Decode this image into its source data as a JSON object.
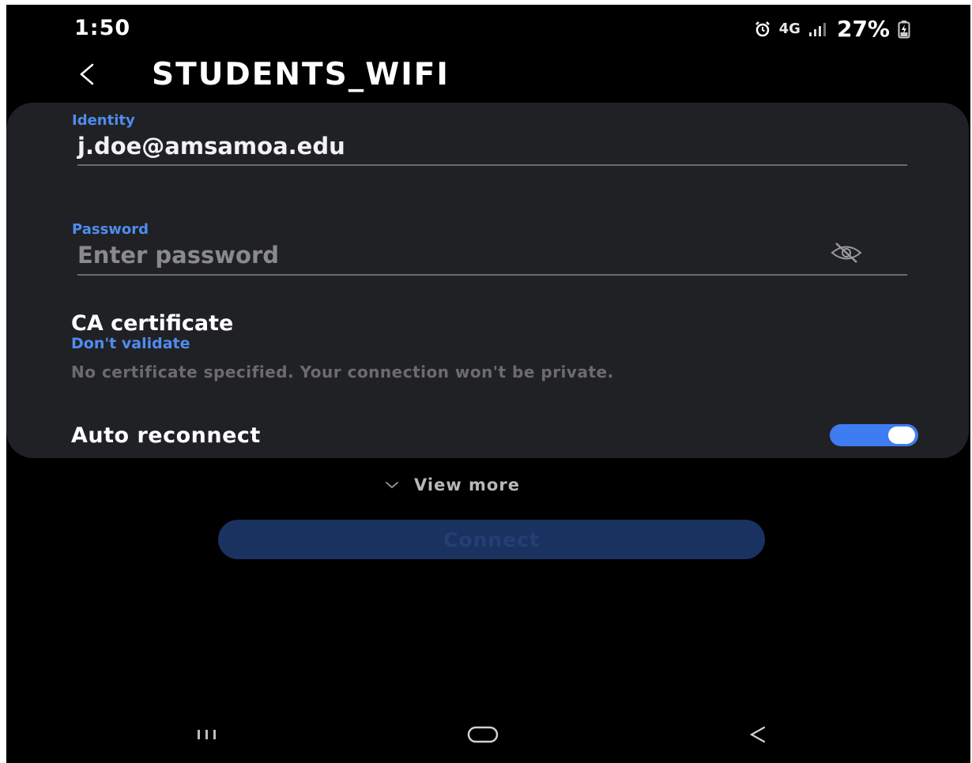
{
  "status_bar": {
    "time": "1:50",
    "network": "4G",
    "battery": "27%",
    "icons": [
      "alarm-icon",
      "signal-icon",
      "battery-charging-icon"
    ]
  },
  "header": {
    "title": "STUDENTS_WIFI",
    "back_icon": "chevron-left-icon"
  },
  "form": {
    "identity": {
      "label": "Identity",
      "value": "j.doe@amsamoa.edu"
    },
    "password": {
      "label": "Password",
      "placeholder": "Enter password",
      "toggle_icon": "eye-off-icon"
    },
    "ca_certificate": {
      "title": "CA certificate",
      "value": "Don't validate",
      "warning": "No certificate specified. Your connection won't be private."
    },
    "auto_reconnect": {
      "label": "Auto reconnect",
      "enabled": true
    }
  },
  "view_more": {
    "label": "View more",
    "icon": "chevron-down-icon"
  },
  "connect": {
    "label": "Connect",
    "enabled": false
  },
  "nav_bar": {
    "items": [
      "recent-apps-icon",
      "home-icon",
      "back-icon"
    ]
  },
  "colors": {
    "accent": "#4f8cf0",
    "toggle_on": "#3e7cf2",
    "card_bg": "#202124",
    "screen_bg": "#000000",
    "button_disabled": "#1a3260"
  }
}
